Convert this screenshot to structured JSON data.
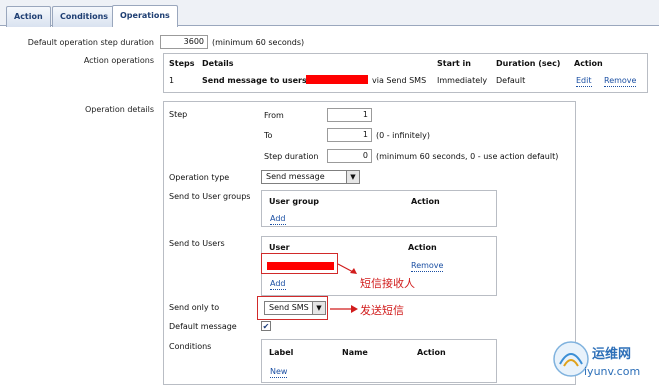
{
  "tabs": [
    {
      "label": "Action"
    },
    {
      "label": "Conditions"
    },
    {
      "label": "Operations"
    }
  ],
  "default_step_duration": {
    "label": "Default operation step duration",
    "value": "3600",
    "hint": "(minimum 60 seconds)"
  },
  "action_operations": {
    "label": "Action operations",
    "headers": [
      "Steps",
      "Details",
      "Start in",
      "Duration (sec)",
      "Action"
    ],
    "row": {
      "steps": "1",
      "details_prefix": "Send message to users:",
      "details_suffix": "via Send SMS",
      "start_in": "Immediately",
      "duration": "Default",
      "edit": "Edit",
      "remove": "Remove"
    }
  },
  "operation_details": {
    "label": "Operation details",
    "step_label": "Step",
    "from_label": "From",
    "from_value": "1",
    "to_label": "To",
    "to_value": "1",
    "to_hint": "(0 - infinitely)",
    "step_duration_label": "Step duration",
    "step_duration_value": "0",
    "step_duration_hint": "(minimum 60 seconds, 0 - use action default)",
    "operation_type_label": "Operation type",
    "operation_type_value": "Send message",
    "send_to_groups_label": "Send to User groups",
    "groups_headers": [
      "User group",
      "Action"
    ],
    "groups_add": "Add",
    "send_to_users_label": "Send to Users",
    "users_headers": [
      "User",
      "Action"
    ],
    "users_remove": "Remove",
    "users_add": "Add",
    "send_only_to_label": "Send only to",
    "send_only_to_value": "Send SMS",
    "default_message_label": "Default message",
    "default_message_checked": true,
    "conditions_label": "Conditions",
    "conditions_headers": [
      "Label",
      "Name",
      "Action"
    ],
    "conditions_new": "New"
  },
  "annotations": {
    "recipient": "短信接收人",
    "send_sms": "发送短信"
  },
  "watermark": {
    "text_cn": "运维网",
    "url": "iyunv.com"
  },
  "colors": {
    "link": "#1a4fa3",
    "redaction": "#ff0000",
    "annotation": "#d11c1c"
  }
}
